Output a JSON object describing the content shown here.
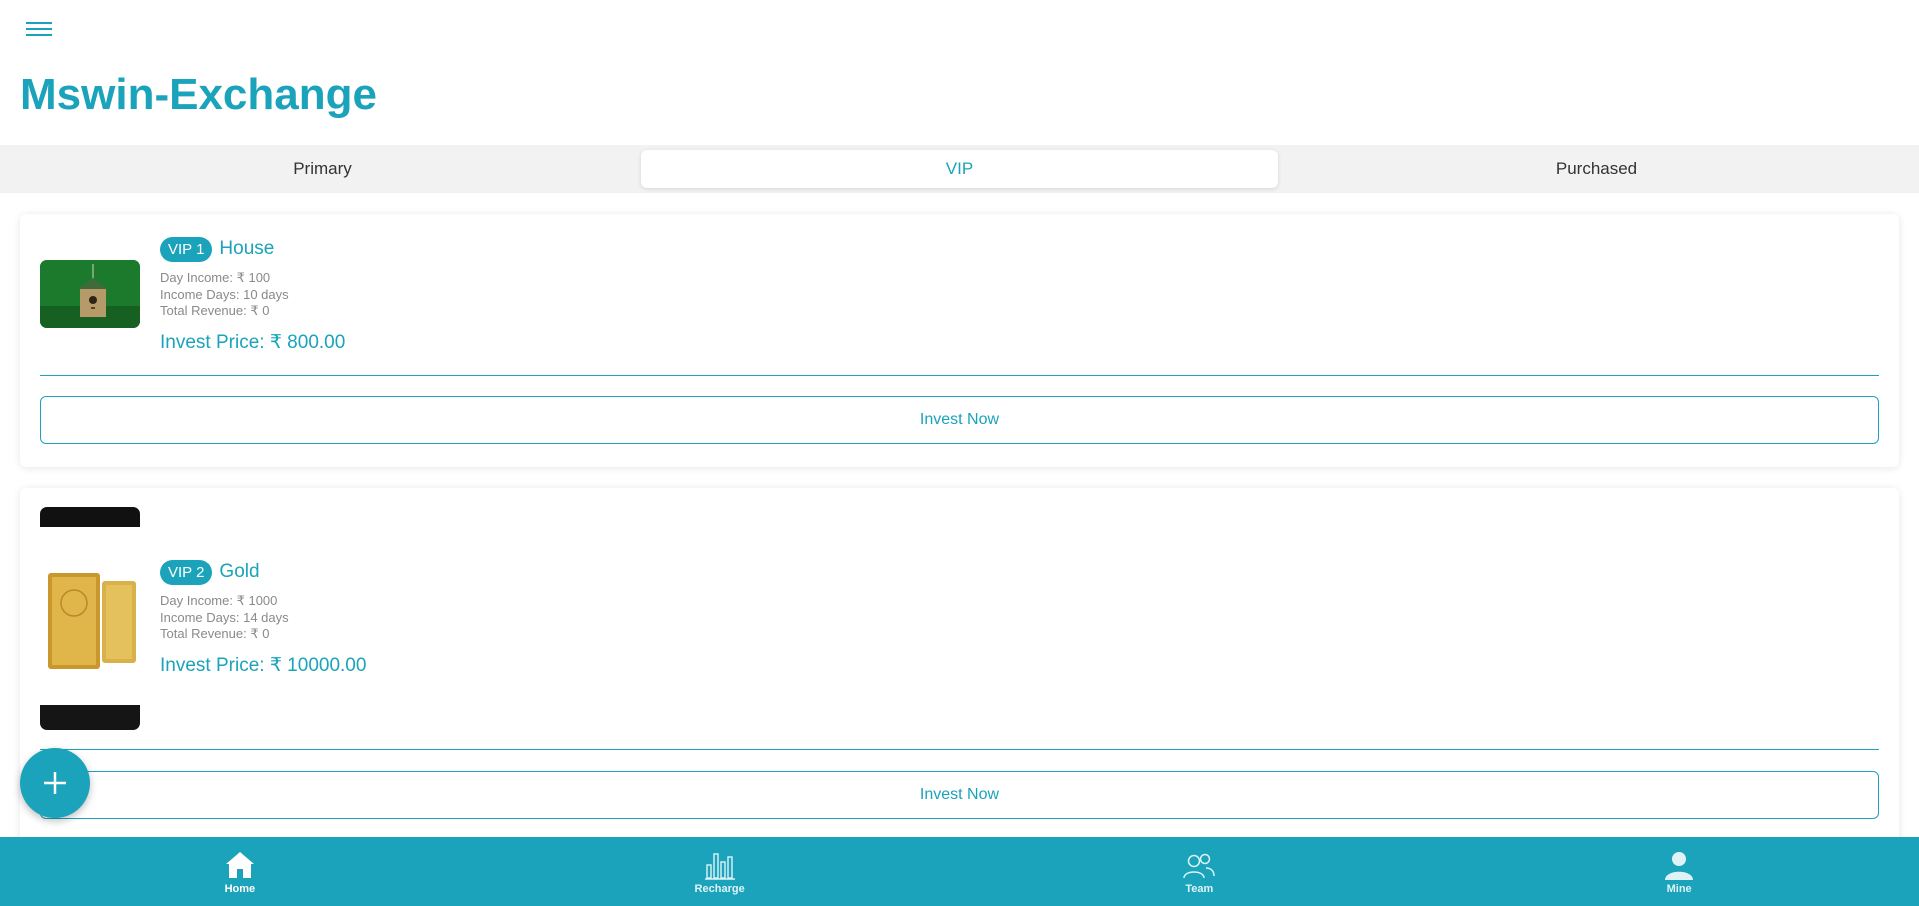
{
  "header": {
    "title": "Mswin-Exchange",
    "menu_icon": "hamburger-menu-icon"
  },
  "tabs": [
    {
      "label": "Primary",
      "active": false
    },
    {
      "label": "VIP",
      "active": true
    },
    {
      "label": "Purchased",
      "active": false
    }
  ],
  "products": [
    {
      "badge": "VIP 1",
      "name": "House",
      "day_income": "Day Income: ₹ 100",
      "income_days": "Income Days: 10 days",
      "total_revenue": "Total Revenue: ₹ 0",
      "invest_price": "Invest Price: ₹ 800.00",
      "button_label": "Invest Now",
      "image": "birdhouse-on-grass-photo"
    },
    {
      "badge": "VIP 2",
      "name": "Gold",
      "day_income": "Day Income: ₹ 1000",
      "income_days": "Income Days: 14 days",
      "total_revenue": "Total Revenue: ₹ 0",
      "invest_price": "Invest Price: ₹ 10000.00",
      "button_label": "Invest Now",
      "image": "gold-bar-photo"
    }
  ],
  "fab": {
    "icon": "plus-icon"
  },
  "bottom_nav": [
    {
      "label": "Home",
      "icon": "home-icon",
      "active": true
    },
    {
      "label": "Recharge",
      "icon": "bar-chart-icon",
      "active": false
    },
    {
      "label": "Team",
      "icon": "team-icon",
      "active": false
    },
    {
      "label": "Mine",
      "icon": "user-icon",
      "active": false
    }
  ],
  "colors": {
    "accent": "#1aa3ba",
    "tab_bar_bg": "#f2f2f2",
    "detail_text": "#8a8a8a"
  }
}
